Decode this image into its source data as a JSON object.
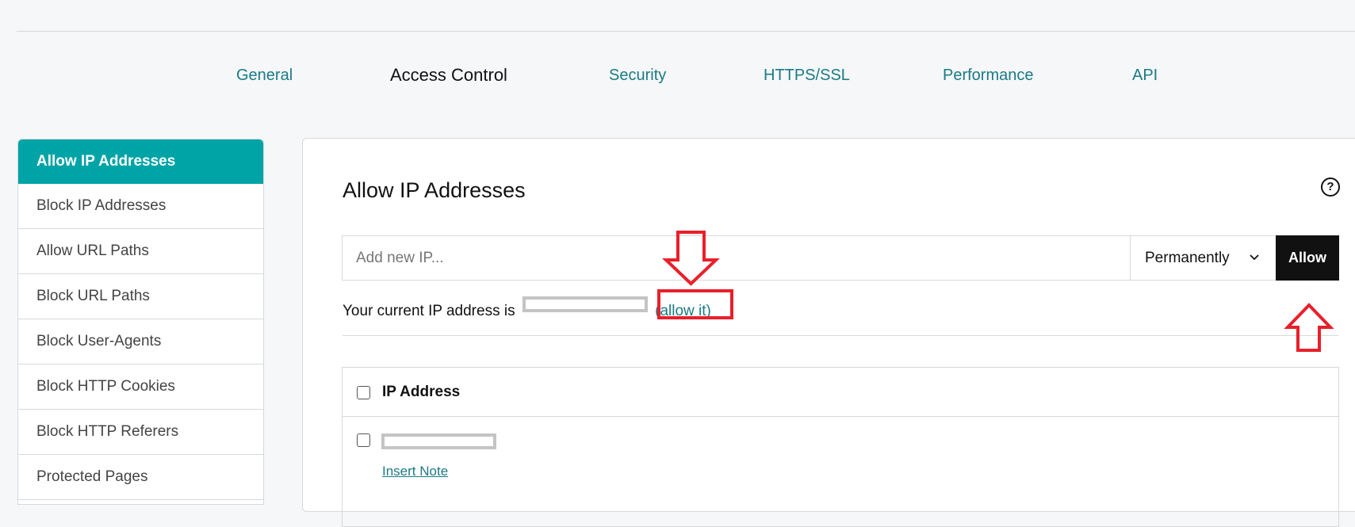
{
  "nav": {
    "tabs": [
      {
        "label": "General",
        "active": false
      },
      {
        "label": "Access Control",
        "active": true
      },
      {
        "label": "Security",
        "active": false
      },
      {
        "label": "HTTPS/SSL",
        "active": false
      },
      {
        "label": "Performance",
        "active": false
      },
      {
        "label": "API",
        "active": false
      }
    ]
  },
  "sidebar": {
    "items": [
      {
        "label": "Allow IP Addresses",
        "active": true
      },
      {
        "label": "Block IP Addresses"
      },
      {
        "label": "Allow URL Paths"
      },
      {
        "label": "Block URL Paths"
      },
      {
        "label": "Block User-Agents"
      },
      {
        "label": "Block HTTP Cookies"
      },
      {
        "label": "Block HTTP Referers"
      },
      {
        "label": "Protected Pages"
      }
    ]
  },
  "main": {
    "title": "Allow IP Addresses",
    "help_icon": "question-circle-icon",
    "ip_input": {
      "placeholder": "Add new IP...",
      "value": ""
    },
    "duration": {
      "selected": "Permanently",
      "icon": "chevron-down-icon"
    },
    "allow_button": "Allow",
    "current_ip_prefix": "Your current IP address is",
    "current_ip_value": "[redacted]",
    "allow_it_link": "(allow it)",
    "table": {
      "header": "IP Address",
      "rows": [
        {
          "ip": "[redacted]",
          "note_link": "Insert Note"
        }
      ]
    }
  },
  "annotations": {
    "color": "#e8202a",
    "items": [
      "down-arrow pointing to (allow it)",
      "box around (allow it)",
      "up-arrow pointing to Allow button"
    ]
  },
  "colors": {
    "accent_teal": "#00a4a6",
    "link_teal": "#1b7a85",
    "button_black": "#111111",
    "background": "#f5f7f8"
  }
}
